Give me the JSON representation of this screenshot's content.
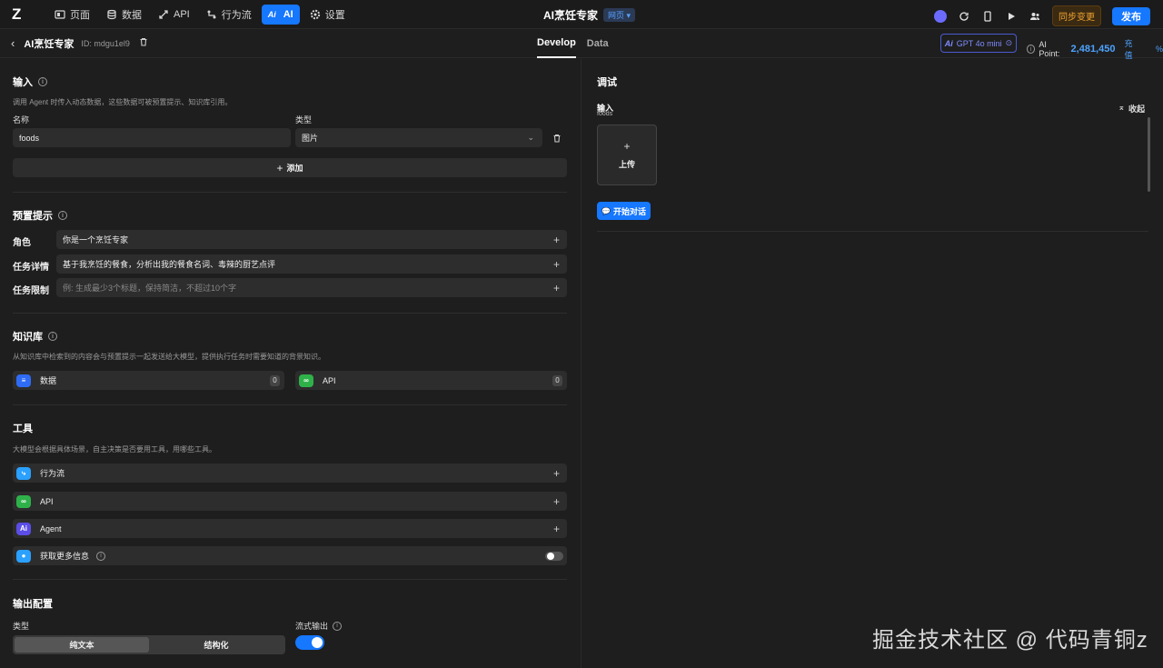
{
  "topbar": {
    "logo": "Z",
    "nav": [
      {
        "label": "页面",
        "icon": "page-icon"
      },
      {
        "label": "数据",
        "icon": "database-icon"
      },
      {
        "label": "API",
        "icon": "api-icon"
      },
      {
        "label": "行为流",
        "icon": "flow-icon"
      },
      {
        "label": "AI",
        "icon": "ai-icon"
      },
      {
        "label": "设置",
        "icon": "gear-icon"
      }
    ],
    "app_title": "AI烹饪专家",
    "env_badge": "网页",
    "sync_label": "同步变更",
    "publish_label": "发布"
  },
  "subbar": {
    "agent_name": "AI烹饪专家",
    "agent_id": "ID: mdgu1el9",
    "tabs": [
      "Develop",
      "Data"
    ],
    "model_label": "GPT 4o mini",
    "ai_point_label": "AI Point:",
    "ai_point_value": "2,481,450",
    "charge_label": "充值",
    "pct_label": "%"
  },
  "input_section": {
    "title": "输入",
    "description": "调用 Agent 时传入动态数据，这些数据可被预置提示、知识库引用。",
    "name_label": "名称",
    "type_label": "类型",
    "name_value": "foods",
    "type_value": "图片",
    "add_label": "添加"
  },
  "preset_section": {
    "title": "预置提示",
    "rows": [
      {
        "label": "角色",
        "value": "你是一个烹饪专家",
        "placeholder": false
      },
      {
        "label": "任务详情",
        "value": "基于我烹饪的餐食，分析出我的餐食名词、毒辣的厨艺点评",
        "placeholder": false
      },
      {
        "label": "任务限制",
        "value": "例: 生成最少3个标题，保持简洁，不超过10个字",
        "placeholder": true
      }
    ]
  },
  "kb_section": {
    "title": "知识库",
    "description": "从知识库中检索到的内容会与预置提示一起发送给大模型，提供执行任务时需要知道的背景知识。",
    "items": [
      {
        "label": "数据",
        "count": "0"
      },
      {
        "label": "API",
        "count": "0"
      }
    ]
  },
  "tools_section": {
    "title": "工具",
    "description": "大模型会根据具体场景，自主决策是否要用工具，用哪些工具。",
    "items": [
      {
        "label": "行为流",
        "icon_text": "⤷"
      },
      {
        "label": "API",
        "icon_text": "∞"
      },
      {
        "label": "Agent",
        "icon_text": "Ai"
      },
      {
        "label": "获取更多信息",
        "icon_text": "●"
      }
    ]
  },
  "output_section": {
    "title": "输出配置",
    "type_label": "类型",
    "stream_label": "流式输出",
    "options": [
      "纯文本",
      "结构化"
    ]
  },
  "debug": {
    "title": "调试",
    "input_label": "输入",
    "var_name": "foods",
    "collapse_label": "收起",
    "upload_label": "上传",
    "start_label": "开始对话"
  },
  "watermark": "掘金技术社区 @ 代码青铜z"
}
